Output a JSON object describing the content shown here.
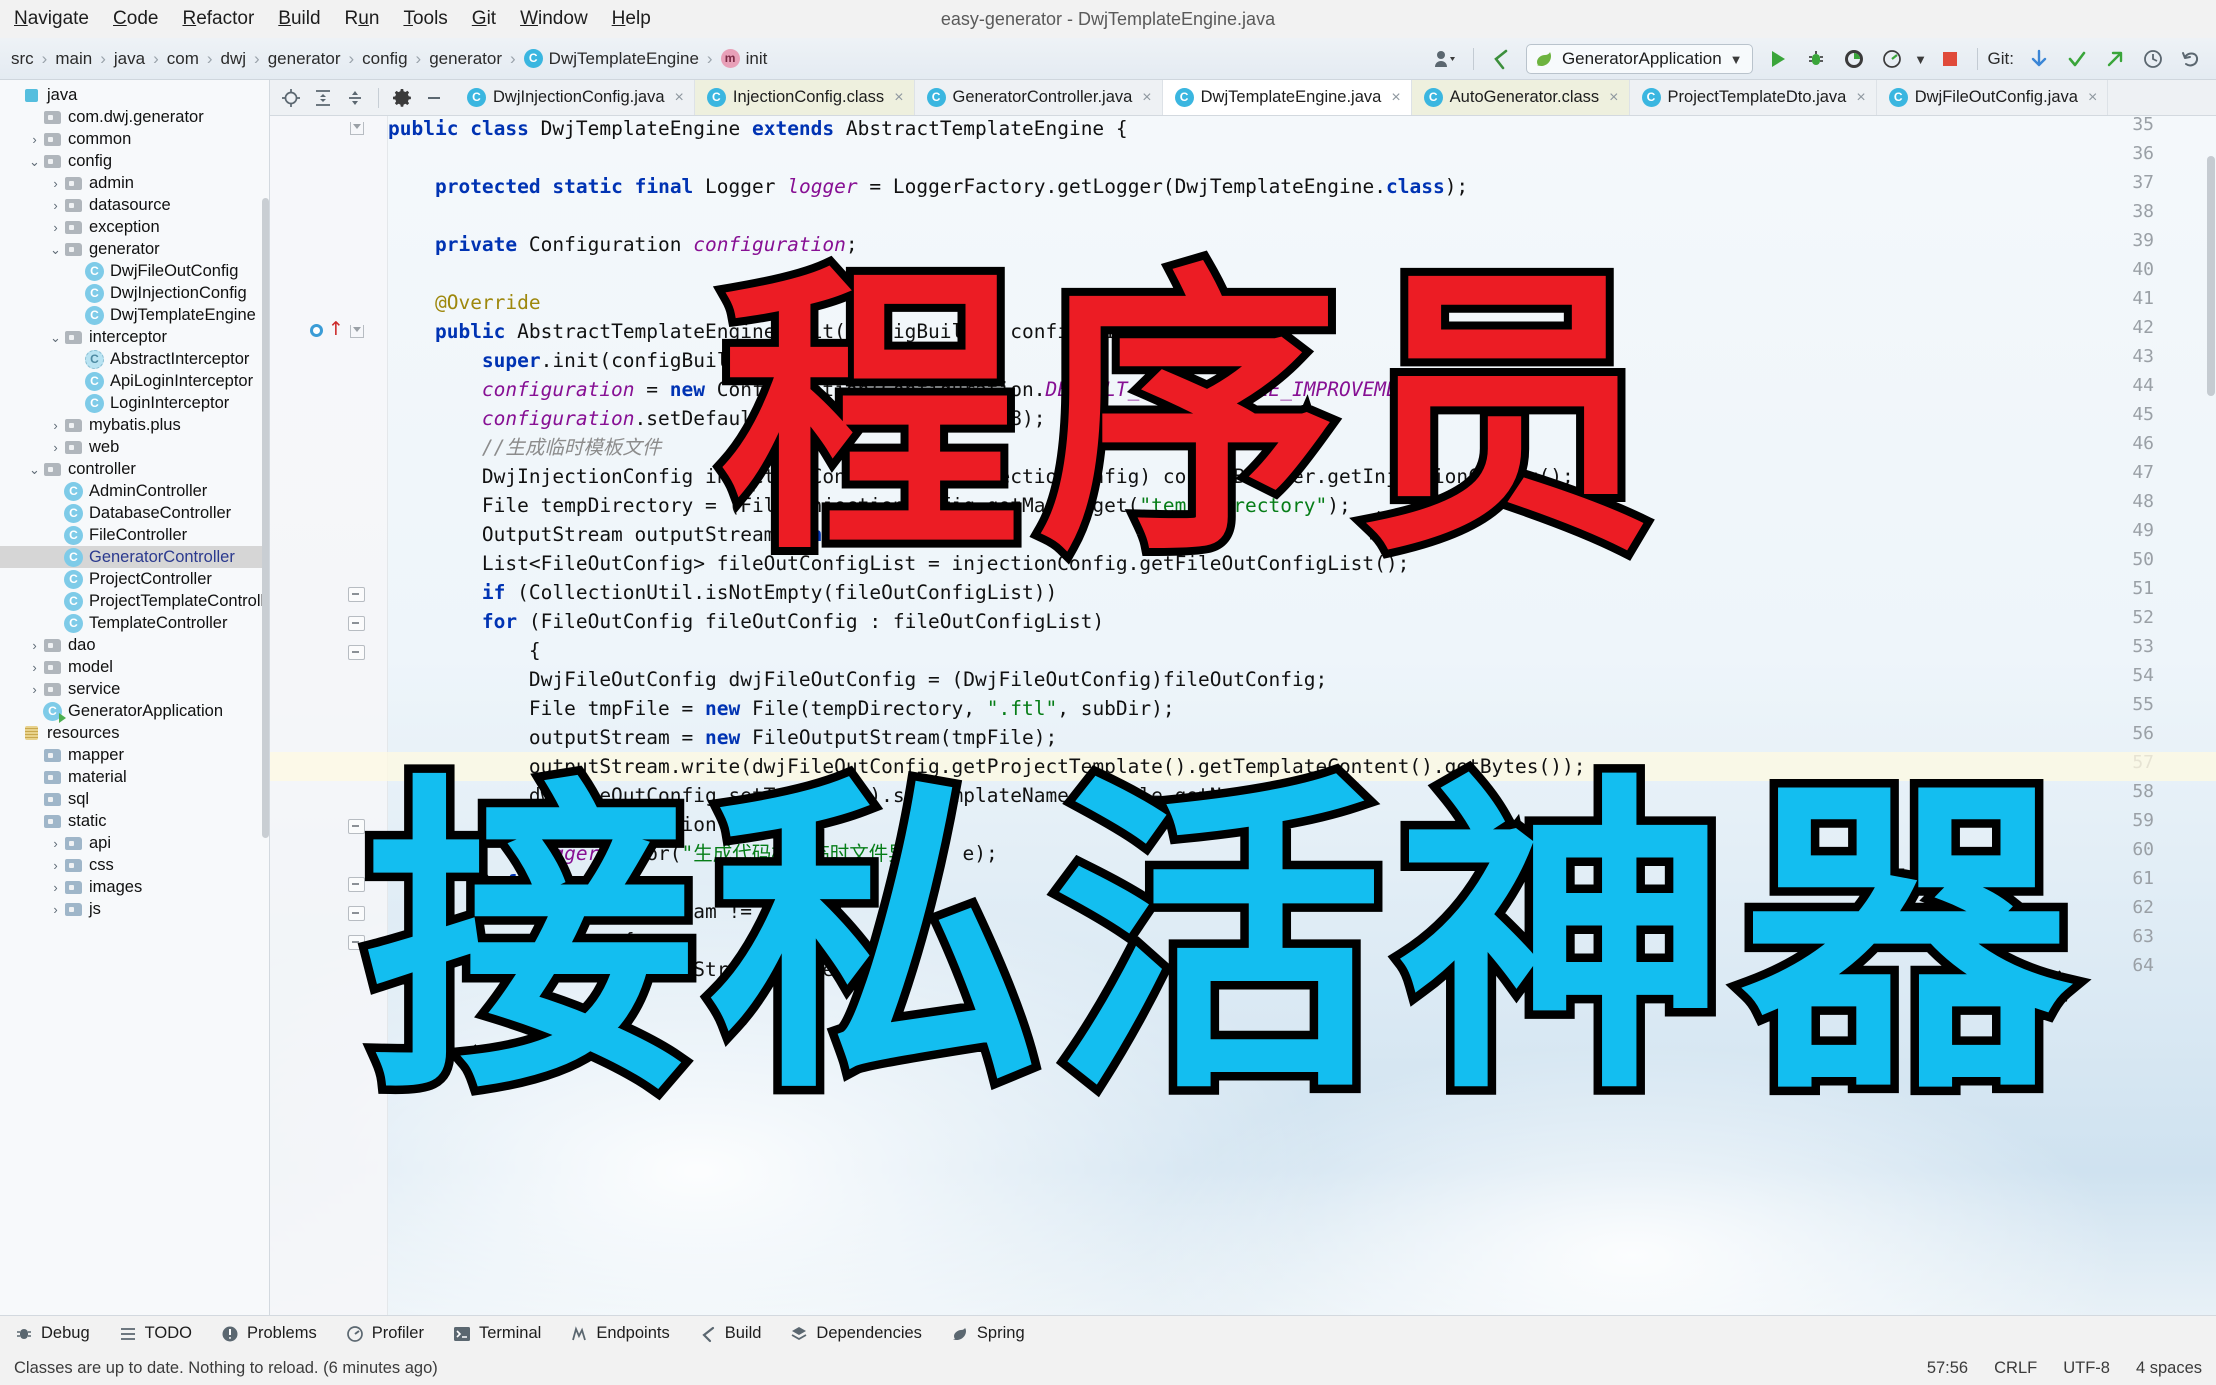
{
  "window": {
    "title": "easy-generator - DwjTemplateEngine.java"
  },
  "menubar": {
    "items": [
      {
        "label": "Navigate",
        "mnemonic": "N"
      },
      {
        "label": "Code",
        "mnemonic": "C"
      },
      {
        "label": "Refactor",
        "mnemonic": "R"
      },
      {
        "label": "Build",
        "mnemonic": "B"
      },
      {
        "label": "Run",
        "mnemonic": "u"
      },
      {
        "label": "Tools",
        "mnemonic": "T"
      },
      {
        "label": "Git",
        "mnemonic": "G"
      },
      {
        "label": "Window",
        "mnemonic": "W"
      },
      {
        "label": "Help",
        "mnemonic": "H"
      }
    ]
  },
  "breadcrumb": {
    "items": [
      {
        "label": "src",
        "type": "folder"
      },
      {
        "label": "main",
        "type": "folder"
      },
      {
        "label": "java",
        "type": "folder"
      },
      {
        "label": "com",
        "type": "folder"
      },
      {
        "label": "dwj",
        "type": "folder"
      },
      {
        "label": "generator",
        "type": "folder"
      },
      {
        "label": "config",
        "type": "folder"
      },
      {
        "label": "generator",
        "type": "folder"
      },
      {
        "label": "DwjTemplateEngine",
        "type": "class"
      },
      {
        "label": "init",
        "type": "method"
      }
    ]
  },
  "toolbar": {
    "run_config": "GeneratorApplication",
    "git_label": "Git:",
    "icons": [
      "user-settings-icon",
      "back-arrow-icon",
      "run-icon",
      "debug-icon",
      "run-coverage-icon",
      "profiler-icon",
      "stop-icon",
      "git-update-icon",
      "git-commit-icon",
      "git-push-icon",
      "git-history-icon",
      "git-rollback-icon"
    ]
  },
  "sidebar": {
    "tree": [
      {
        "label": "java",
        "depth": 0,
        "icon": "source-root-icon",
        "arrow": ""
      },
      {
        "label": "com.dwj.generator",
        "depth": 1,
        "icon": "package-icon",
        "arrow": ""
      },
      {
        "label": "common",
        "depth": 1,
        "icon": "package-icon",
        "arrow": "collapsed"
      },
      {
        "label": "config",
        "depth": 1,
        "icon": "package-icon",
        "arrow": "expanded"
      },
      {
        "label": "admin",
        "depth": 2,
        "icon": "package-icon",
        "arrow": "collapsed"
      },
      {
        "label": "datasource",
        "depth": 2,
        "icon": "package-icon",
        "arrow": "collapsed"
      },
      {
        "label": "exception",
        "depth": 2,
        "icon": "package-icon",
        "arrow": "collapsed"
      },
      {
        "label": "generator",
        "depth": 2,
        "icon": "package-icon",
        "arrow": "expanded"
      },
      {
        "label": "DwjFileOutConfig",
        "depth": 3,
        "icon": "class-icon",
        "arrow": ""
      },
      {
        "label": "DwjInjectionConfig",
        "depth": 3,
        "icon": "class-icon",
        "arrow": ""
      },
      {
        "label": "DwjTemplateEngine",
        "depth": 3,
        "icon": "class-icon",
        "arrow": ""
      },
      {
        "label": "interceptor",
        "depth": 2,
        "icon": "package-icon",
        "arrow": "expanded"
      },
      {
        "label": "AbstractInterceptor",
        "depth": 3,
        "icon": "abstract-class-icon",
        "arrow": ""
      },
      {
        "label": "ApiLoginInterceptor",
        "depth": 3,
        "icon": "class-icon",
        "arrow": ""
      },
      {
        "label": "LoginInterceptor",
        "depth": 3,
        "icon": "class-icon",
        "arrow": ""
      },
      {
        "label": "mybatis.plus",
        "depth": 2,
        "icon": "package-icon",
        "arrow": "collapsed"
      },
      {
        "label": "web",
        "depth": 2,
        "icon": "package-icon",
        "arrow": "collapsed"
      },
      {
        "label": "controller",
        "depth": 1,
        "icon": "package-icon",
        "arrow": "expanded"
      },
      {
        "label": "AdminController",
        "depth": 2,
        "icon": "class-icon",
        "arrow": ""
      },
      {
        "label": "DatabaseController",
        "depth": 2,
        "icon": "class-icon",
        "arrow": ""
      },
      {
        "label": "FileController",
        "depth": 2,
        "icon": "class-icon",
        "arrow": ""
      },
      {
        "label": "GeneratorController",
        "depth": 2,
        "icon": "class-icon",
        "arrow": "",
        "selected": true
      },
      {
        "label": "ProjectController",
        "depth": 2,
        "icon": "class-icon",
        "arrow": ""
      },
      {
        "label": "ProjectTemplateController",
        "depth": 2,
        "icon": "class-icon",
        "arrow": ""
      },
      {
        "label": "TemplateController",
        "depth": 2,
        "icon": "class-icon",
        "arrow": ""
      },
      {
        "label": "dao",
        "depth": 1,
        "icon": "package-icon",
        "arrow": "collapsed"
      },
      {
        "label": "model",
        "depth": 1,
        "icon": "package-icon",
        "arrow": "collapsed"
      },
      {
        "label": "service",
        "depth": 1,
        "icon": "package-icon",
        "arrow": "collapsed"
      },
      {
        "label": "GeneratorApplication",
        "depth": 1,
        "icon": "runnable-class-icon",
        "arrow": ""
      },
      {
        "label": "resources",
        "depth": 0,
        "icon": "resource-root-icon",
        "arrow": ""
      },
      {
        "label": "mapper",
        "depth": 1,
        "icon": "folder-icon",
        "arrow": ""
      },
      {
        "label": "material",
        "depth": 1,
        "icon": "folder-icon",
        "arrow": ""
      },
      {
        "label": "sql",
        "depth": 1,
        "icon": "folder-icon",
        "arrow": ""
      },
      {
        "label": "static",
        "depth": 1,
        "icon": "folder-icon",
        "arrow": ""
      },
      {
        "label": "api",
        "depth": 2,
        "icon": "folder-icon",
        "arrow": "collapsed"
      },
      {
        "label": "css",
        "depth": 2,
        "icon": "folder-icon",
        "arrow": "collapsed"
      },
      {
        "label": "images",
        "depth": 2,
        "icon": "folder-icon",
        "arrow": "collapsed"
      },
      {
        "label": "js",
        "depth": 2,
        "icon": "folder-icon",
        "arrow": "collapsed"
      }
    ]
  },
  "tabs": [
    {
      "label": "DwjInjectionConfig.java",
      "state": "normal"
    },
    {
      "label": "InjectionConfig.class",
      "state": "readonly"
    },
    {
      "label": "GeneratorController.java",
      "state": "normal"
    },
    {
      "label": "DwjTemplateEngine.java",
      "state": "current"
    },
    {
      "label": "AutoGenerator.class",
      "state": "readonly"
    },
    {
      "label": "ProjectTemplateDto.java",
      "state": "normal"
    },
    {
      "label": "DwjFileOutConfig.java",
      "state": "normal"
    }
  ],
  "code": {
    "first_line": 35,
    "lines": [
      {
        "n": 35,
        "text": "public class DwjTemplateEngine extends AbstractTemplateEngine {"
      },
      {
        "n": 36,
        "text": ""
      },
      {
        "n": 37,
        "text": "    protected static final Logger logger = LoggerFactory.getLogger(DwjTemplateEngine.class);"
      },
      {
        "n": 38,
        "text": ""
      },
      {
        "n": 39,
        "text": "    private Configuration configuration;"
      },
      {
        "n": 40,
        "text": ""
      },
      {
        "n": 41,
        "text": "    @Override"
      },
      {
        "n": 42,
        "text": "    public AbstractTemplateEngine init(ConfigBuilder configBuilder) {"
      },
      {
        "n": 43,
        "text": "        super.init(configBuilder);"
      },
      {
        "n": 44,
        "text": "        configuration = new Configuration(Configuration.DEFAULT_INCOMPATIBLE_IMPROVEMENTS);"
      },
      {
        "n": 45,
        "text": "        configuration.setDefaultEncoding(ConstVal.UTF8);"
      },
      {
        "n": 46,
        "text": "        //生成临时模板文件"
      },
      {
        "n": 47,
        "text": "        DwjInjectionConfig injectionConfig = (DwjInjectionConfig) configBuilder.getInjectionConfig();"
      },
      {
        "n": 48,
        "text": "        File tempDirectory = (File)injectionConfig.getMap().get(\"temp_directory\");"
      },
      {
        "n": 49,
        "text": "        OutputStream outputStream = null;"
      },
      {
        "n": 50,
        "text": "        List<FileOutConfig> fileOutConfigList = injectionConfig.getFileOutConfigList();"
      },
      {
        "n": 51,
        "text": "        if (CollectionUtil.isNotEmpty(fileOutConfigList))"
      },
      {
        "n": 52,
        "text": "        for (FileOutConfig fileOutConfig : fileOutConfigList)"
      },
      {
        "n": 53,
        "text": "            {"
      },
      {
        "n": 54,
        "text": "            DwjFileOutConfig dwjFileOutConfig = (DwjFileOutConfig)fileOutConfig;"
      },
      {
        "n": 55,
        "text": "            File tmpFile = new File(tempDirectory, \".ftl\", subDir);"
      },
      {
        "n": 56,
        "text": "            outputStream = new FileOutputStream(tmpFile);"
      },
      {
        "n": 57,
        "text": "            outputStream.write(dwjFileOutConfig.getProjectTemplate().getTemplateContent().getBytes());"
      },
      {
        "n": 58,
        "text": "            dwjFileOutConfig.setTemplate().setTemplateName(tmpFile.getName());"
      },
      {
        "n": 59,
        "text": "        } catch (IOException e) {"
      },
      {
        "n": 60,
        "text": "            logger.error(\"生成代码模板临时文件异常\", e);"
      },
      {
        "n": 61,
        "text": "        } finally {"
      },
      {
        "n": 62,
        "text": "            if (outputStream != null) {"
      },
      {
        "n": 63,
        "text": "                try {"
      },
      {
        "n": 64,
        "text": "                    outputStream.close();"
      }
    ]
  },
  "overlay": {
    "line1": "程序员",
    "line2": "接私活神器",
    "line1_color": "#ec1c24",
    "line2_color": "#13bef0",
    "stroke_color": "#000000"
  },
  "toolwindows": [
    {
      "label": "Debug",
      "icon": "debug-icon"
    },
    {
      "label": "TODO",
      "icon": "todo-icon"
    },
    {
      "label": "Problems",
      "icon": "problems-icon"
    },
    {
      "label": "Profiler",
      "icon": "profiler-icon"
    },
    {
      "label": "Terminal",
      "icon": "terminal-icon"
    },
    {
      "label": "Endpoints",
      "icon": "endpoints-icon"
    },
    {
      "label": "Build",
      "icon": "build-icon"
    },
    {
      "label": "Dependencies",
      "icon": "dependencies-icon"
    },
    {
      "label": "Spring",
      "icon": "spring-icon"
    }
  ],
  "status": {
    "message": "Classes are up to date. Nothing to reload. (6 minutes ago)",
    "caret": "57:56",
    "line_separator": "CRLF",
    "encoding": "UTF-8",
    "indent": "4 spaces"
  }
}
